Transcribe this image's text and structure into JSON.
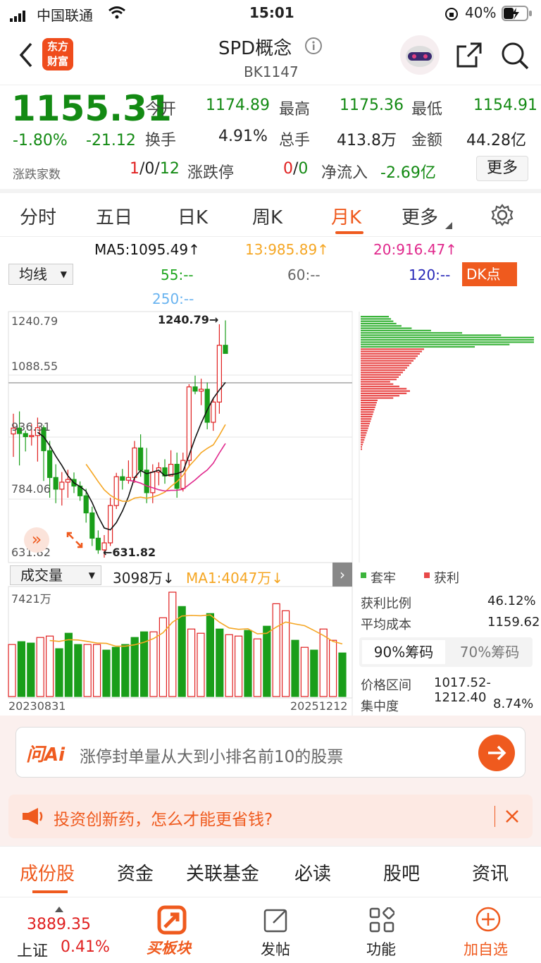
{
  "status": {
    "carrier": "中国联通",
    "time": "15:01",
    "battery": "40%"
  },
  "header": {
    "title": "SPD概念",
    "code": "BK1147",
    "logo_line1": "东方",
    "logo_line2": "财富"
  },
  "quote": {
    "price": "1155.31",
    "change_pct": "-1.80%",
    "change": "-21.12",
    "open_label": "今开",
    "open": "1174.89",
    "high_label": "最高",
    "high": "1175.36",
    "low_label": "最低",
    "low": "1154.91",
    "turnover_label": "换手",
    "turnover": "4.91%",
    "volume_label": "总手",
    "volume": "413.8万",
    "amount_label": "金额",
    "amount": "44.28亿",
    "breadth_label": "涨跌家数",
    "up": "1",
    "flat": "0",
    "down": "12",
    "limit_label": "涨跌停",
    "limit_up": "0",
    "limit_down": "0",
    "netflow_label": "净流入",
    "netflow": "-2.69亿",
    "more": "更多"
  },
  "ktabs": [
    "分时",
    "五日",
    "日K",
    "周K",
    "月K",
    "更多"
  ],
  "ma": {
    "ma5": "MA5:1095.49↑",
    "ma13": "13:985.89↑",
    "ma20": "20:916.47↑",
    "ma55": "55:--",
    "ma60": "60:--",
    "ma120": "120:--",
    "ma250": "250:--",
    "select": "均线",
    "dk": "DK点"
  },
  "chart": {
    "y_labels": [
      "1240.79",
      "1088.55",
      "936.31",
      "784.06",
      "631.82"
    ],
    "max_mark": "1240.79→",
    "min_mark": "←631.82",
    "vol_select": "成交量",
    "vol_value": "3098万↓",
    "vol_ma": "MA1:4047万↓",
    "vol_max": "7421万",
    "date_start": "20230831",
    "date_end": "20251212"
  },
  "chip": {
    "legend_trapped": "套牢",
    "legend_profit": "获利",
    "profit_ratio_label": "获利比例",
    "profit_ratio": "46.12%",
    "avg_cost_label": "平均成本",
    "avg_cost": "1159.62",
    "tab90": "90%筹码",
    "tab70": "70%筹码",
    "range_label": "价格区间",
    "range": "1017.52-1212.40",
    "concentration_label": "集中度",
    "concentration": "8.74%"
  },
  "ai": {
    "brand": "问Ai",
    "prompt": "涨停封单量从大到小排名前10的股票"
  },
  "ad": {
    "text": "投资创新药，怎么才能更省钱?"
  },
  "btabs": [
    "成份股",
    "资金",
    "关联基金",
    "必读",
    "股吧",
    "资讯"
  ],
  "bottom": {
    "index_value": "3889.35",
    "index_name": "上证",
    "index_pct": "0.41%",
    "buy_board": "买板块",
    "post": "发帖",
    "func": "功能",
    "add": "加自选"
  },
  "chart_data": {
    "type": "candlestick",
    "candles": [
      [
        948,
        1000,
        889,
        963
      ],
      [
        963,
        1006,
        867,
        949
      ],
      [
        949,
        957,
        903,
        941
      ],
      [
        941,
        974,
        918,
        944
      ],
      [
        944,
        990,
        877,
        964
      ],
      [
        964,
        970,
        827,
        905
      ],
      [
        905,
        930,
        784,
        836
      ],
      [
        836,
        870,
        770,
        806
      ],
      [
        806,
        850,
        764,
        824
      ],
      [
        824,
        856,
        784,
        831
      ],
      [
        831,
        849,
        796,
        814
      ],
      [
        814,
        826,
        776,
        789
      ],
      [
        789,
        807,
        720,
        745
      ],
      [
        745,
        761,
        660,
        680
      ],
      [
        680,
        700,
        640,
        650
      ],
      [
        650,
        688,
        630,
        668
      ],
      [
        668,
        784,
        660,
        764
      ],
      [
        764,
        848,
        755,
        838
      ],
      [
        838,
        858,
        805,
        829
      ],
      [
        829,
        880,
        820,
        836
      ],
      [
        836,
        930,
        822,
        912
      ],
      [
        912,
        947,
        838,
        855
      ],
      [
        855,
        912,
        770,
        797
      ],
      [
        797,
        870,
        770,
        850
      ],
      [
        850,
        875,
        816,
        861
      ],
      [
        861,
        883,
        820,
        840
      ],
      [
        840,
        906,
        840,
        870
      ],
      [
        870,
        900,
        784,
        808
      ],
      [
        808,
        900,
        800,
        880
      ],
      [
        880,
        1076,
        862,
        1069
      ],
      [
        1069,
        1098,
        1050,
        1058
      ],
      [
        1058,
        1090,
        1022,
        1063
      ],
      [
        1063,
        1080,
        960,
        978
      ],
      [
        978,
        1040,
        956,
        1030
      ],
      [
        1030,
        1230,
        1000,
        1176
      ],
      [
        1176,
        1240,
        1155,
        1155
      ]
    ],
    "volume": [
      3700,
      3900,
      3800,
      4200,
      4300,
      3400,
      4500,
      3700,
      3700,
      3700,
      3300,
      3500,
      3700,
      4200,
      4600,
      4600,
      5600,
      7421,
      6400,
      4800,
      4500,
      5900,
      4800,
      4400,
      4300,
      4700,
      4100,
      5000,
      6600,
      6100,
      4000,
      3500,
      3300,
      4800,
      4000,
      3098
    ]
  }
}
